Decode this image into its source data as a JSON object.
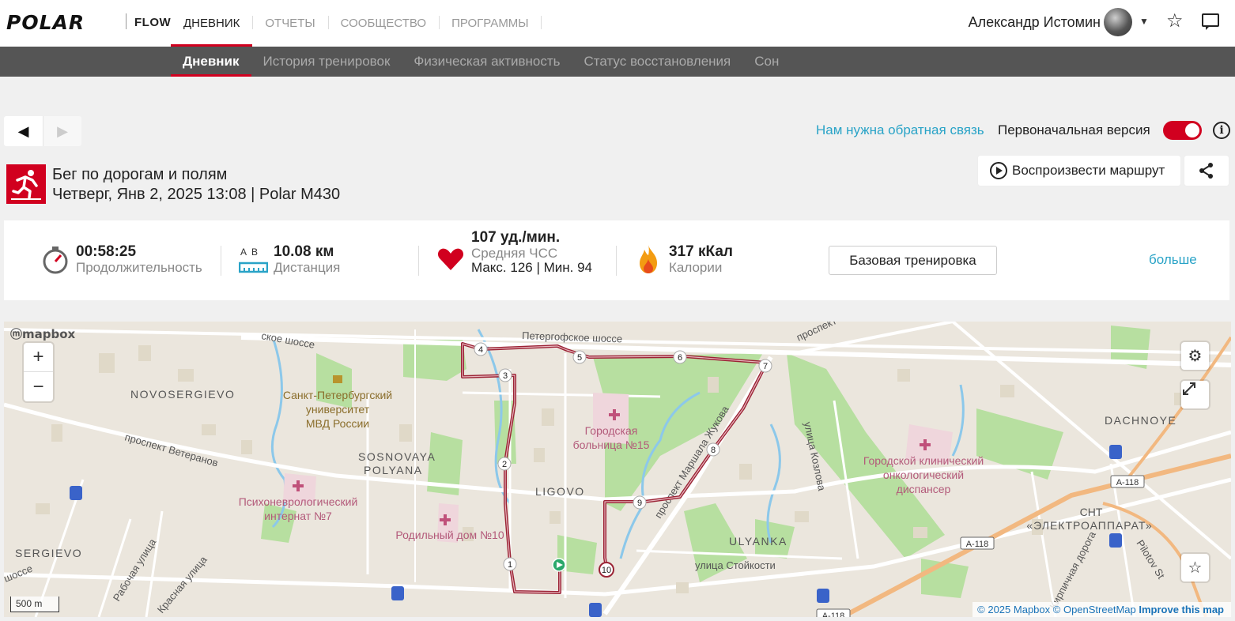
{
  "topbar": {
    "logo": "POLAR",
    "flow": "FLOW",
    "nav": [
      "ДНЕВНИК",
      "ОТЧЕТЫ",
      "СООБЩЕСТВО",
      "ПРОГРАММЫ"
    ],
    "user_name": "Александр Истомин"
  },
  "subnav": [
    "Дневник",
    "История тренировок",
    "Физическая активность",
    "Статус восстановления",
    "Сон"
  ],
  "toolbar": {
    "prev": "◀",
    "next": "▶",
    "feedback": "Нам нужна обратная связь",
    "original_version": "Первоначальная версия",
    "toggle_on": true
  },
  "session": {
    "title": "Бег по дорогам и полям",
    "datetime": "Четверг, Янв 2, 2025 13:08 | Polar M430",
    "replay": "Воспроизвести маршрут"
  },
  "stats": {
    "duration_value": "00:58:25",
    "duration_label": "Продолжительность",
    "distance_ab": "A  B",
    "distance_value": "10.08 км",
    "distance_label": "Дистанция",
    "hr_value": "107 уд./мин.",
    "hr_label": "Средняя ЧСС",
    "hr_minmax": "Макс. 126 | Мин. 94",
    "calories_value": "317 кКал",
    "calories_label": "Калории",
    "base_training": "Базовая тренировка",
    "more": "больше"
  },
  "map": {
    "logo": "mapbox",
    "zoom_in": "+",
    "zoom_out": "−",
    "scale": "500 m",
    "attribution_mapbox": "© 2025 Mapbox",
    "attribution_osm": "© OpenStreetMap",
    "improve": "Improve this map",
    "labels": {
      "novosergievo": "NOVOSERGIEVO",
      "sosnovaya1": "SOSNOVAYA",
      "sosnovaya2": "POLYANA",
      "ligovo": "LIGOVO",
      "sergievo": "SERGIEVO",
      "ulyanka": "ULYANKA",
      "dachnoye": "DACHNOYE",
      "univ1": "Санкт-Петербургский",
      "univ2": "университет",
      "univ3": "МВД России",
      "hosp1": "Городская",
      "hosp2": "больница №15",
      "psych1": "Психоневрологический",
      "psych2": "интернат №7",
      "maternity": "Родильный дом №10",
      "onco1": "Городской клинический",
      "onco2": "онкологический",
      "onco3": "диспансер",
      "elektro": "«ЭЛЕКТРОАППАРАТ»",
      "cnt": "СНТ",
      "petergof": "Петергофское шоссе",
      "veteranov": "проспект Ветеранов",
      "stoikosti": "улица Стойкости",
      "kozlova": "улица Козлова",
      "zhukova": "проспект Маршала Жукова",
      "shosse": "ское шоссе",
      "pilotov": "Pilotov St",
      "a118": "A-118",
      "rabochaya": "Рабочая улица",
      "krasnaya": "Красная улица",
      "kirpich": "Кирпичная дорога",
      "prospekt_ne": "проспект",
      "socce": "шоссе"
    },
    "markers": [
      "1",
      "2",
      "3",
      "4",
      "5",
      "6",
      "7",
      "8",
      "9",
      "10"
    ]
  },
  "colors": {
    "brand_red": "#d1001f",
    "link_blue": "#29a3c7",
    "route": "#9b2335"
  }
}
